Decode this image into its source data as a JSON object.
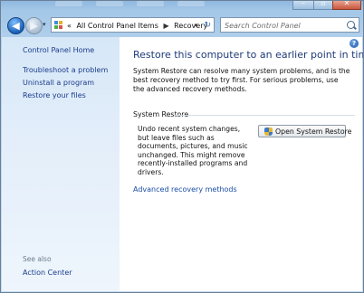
{
  "address_bar": {
    "crumbs": [
      "All Control Panel Items",
      "Recovery"
    ],
    "separator": "▶",
    "back_glyph": "◀",
    "fwd_glyph": "▶",
    "dropdown_glyph": "▾",
    "refresh_glyph": "↻",
    "search_placeholder": "Search Control Panel",
    "chevron": "«",
    "icon": "control-panel-icon"
  },
  "window_controls": {
    "minimize": "–",
    "maximize": "▫",
    "close": "✕"
  },
  "sidebar": {
    "home": "Control Panel Home",
    "items": [
      {
        "label": "Troubleshoot a problem"
      },
      {
        "label": "Uninstall a program"
      },
      {
        "label": "Restore your files"
      }
    ],
    "see_also_label": "See also",
    "see_also_items": [
      {
        "label": "Action Center"
      }
    ]
  },
  "main": {
    "help_glyph": "?",
    "title": "Restore this computer to an earlier point in time",
    "intro": "System Restore can resolve many system problems, and is the best recovery method to try first. For serious problems, use the advanced recovery methods.",
    "section_title": "System Restore",
    "section_desc": "Undo recent system changes, but leave files such as documents, pictures, and music unchanged. This might remove recently-installed programs and drivers.",
    "button_label": "Open System Restore",
    "advanced_link": "Advanced recovery methods"
  },
  "colors": {
    "link": "#1a3c8c",
    "title": "#1e3a78",
    "frame": "#b7d4ee"
  }
}
